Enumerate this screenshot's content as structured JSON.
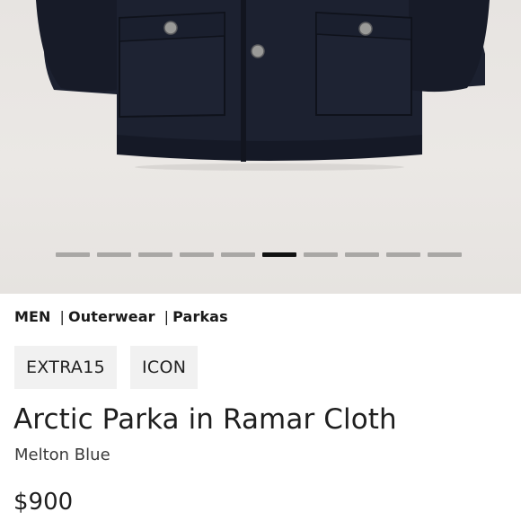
{
  "product_image": {
    "gallery": {
      "slide_count": 10,
      "active_index": 5
    }
  },
  "breadcrumb": {
    "items": [
      "MEN",
      "Outerwear",
      "Parkas"
    ],
    "separator": "|"
  },
  "tags": [
    "EXTRA15",
    "ICON"
  ],
  "product": {
    "name": "Arctic Parka in Ramar Cloth",
    "color": "Melton Blue",
    "price": "$900"
  },
  "colors": {
    "jacket": "#1c2130",
    "background": "#e8e5e2",
    "indicator_active": "#111111",
    "indicator_inactive": "#a9a7a5"
  }
}
